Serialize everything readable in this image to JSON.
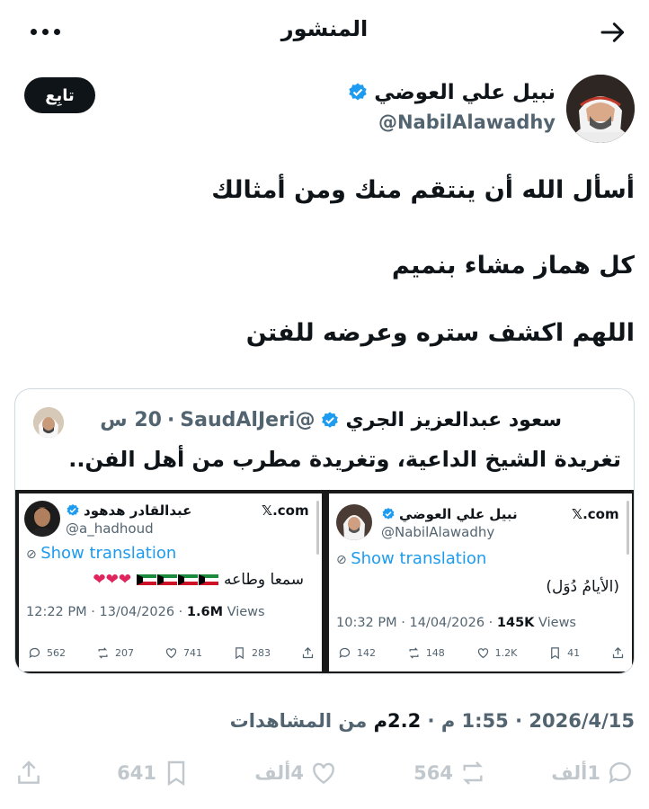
{
  "header": {
    "title": "المنشور"
  },
  "author": {
    "name": "نبيل علي العوضي",
    "handle": "@NabilAlawadhy",
    "follow_label": "تابِع"
  },
  "tweet": {
    "lines": [
      "أسأل الله أن ينتقم منك ومن أمثالك",
      "كل هماز مشاء بنميم",
      "اللهم اكشف ستره وعرضه للفتن"
    ]
  },
  "quote": {
    "name": "سعود عبدالعزيز الجري",
    "handle": "@SaudAlJeri",
    "separator": "·",
    "time": "20 س",
    "text": "تغريدة الشيخ الداعية، وتغريدة مطرب من أهل الفن..",
    "screenshots": {
      "right": {
        "source": "𝕏.com",
        "name": "نبيل علي العوضي",
        "handle": "@NabilAlawadhy",
        "translate": "Show translation",
        "body": "(الأيامُ دُوَل)",
        "time": "10:32 PM · 14/04/2026 · ",
        "views_count": "145K",
        "views_label": " Views",
        "stats": {
          "replies": "142",
          "reposts": "148",
          "likes": "1.2K",
          "bookmarks": "41"
        }
      },
      "left": {
        "source": "𝕏.com",
        "name": "عبدالقادر هدهود",
        "handle": "@a_hadhoud",
        "translate": "Show translation",
        "body": "سمعا وطاعه",
        "time": "12:22 PM · 13/04/2026 · ",
        "views_count": "1.6M",
        "views_label": " Views",
        "stats": {
          "replies": "562",
          "reposts": "207",
          "likes": "741",
          "bookmarks": "283"
        }
      }
    }
  },
  "post_meta": {
    "date": "2026/4/15",
    "time": "1:55 م",
    "views": "2.2م",
    "views_label": "من المشاهدات"
  },
  "actions": {
    "replies": "1ألف",
    "reposts": "564",
    "likes": "4ألف",
    "bookmarks": "641"
  },
  "colors": {
    "accent": "#1d9bf0",
    "text": "#0f1419",
    "muted": "#536471",
    "border": "#cfd9de"
  },
  "icons": [
    "back-arrow-icon",
    "more-icon",
    "verified-icon",
    "translate-icon",
    "reply-icon",
    "repost-icon",
    "like-icon",
    "bookmark-icon",
    "share-icon",
    "kuwait-flag-icon",
    "heart-emoji-icon"
  ]
}
